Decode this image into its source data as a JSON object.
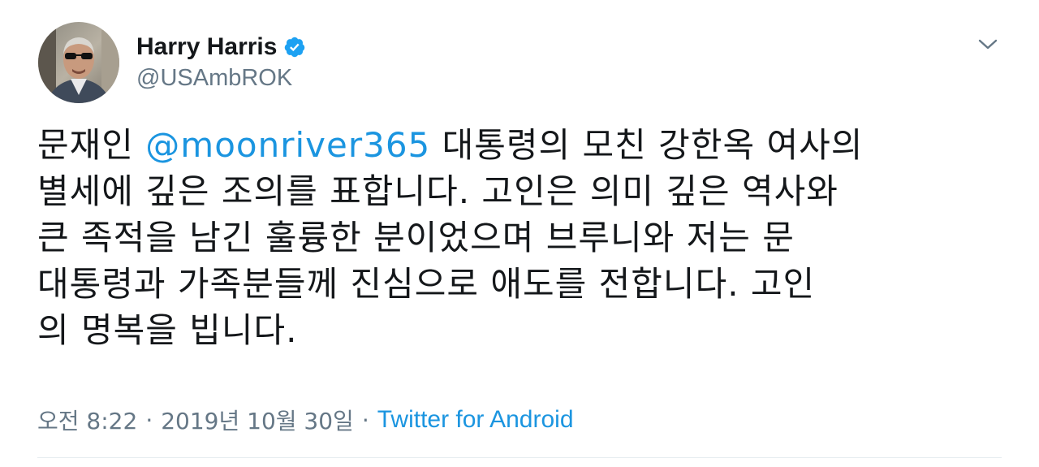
{
  "author": {
    "display_name": "Harry Harris",
    "handle": "@USAmbROK",
    "verified": true,
    "avatar_icon": "profile-photo-sunglasses"
  },
  "tweet": {
    "lines": [
      {
        "pre": "문재인 ",
        "mention": "@moonriver365",
        "post": " 대통령의 모친 강한옥 여사의"
      },
      {
        "text": "별세에 깊은 조의를 표합니다. 고인은 의미 깊은 역사와"
      },
      {
        "text": "큰 족적을 남긴 훌륭한 분이었으며 브루니와 저는 문"
      },
      {
        "text": "대통령과 가족분들께 진심으로 애도를 전합니다. 고인"
      },
      {
        "text": "의 명복을 빕니다."
      }
    ]
  },
  "meta": {
    "time": "오전 8:22",
    "separator": "·",
    "date": "2019년 10월 30일",
    "source": "Twitter for Android"
  },
  "icons": {
    "verified": "verified-badge-icon",
    "menu": "chevron-down-icon"
  },
  "colors": {
    "link": "#1b95e0",
    "text": "#14171a",
    "secondary": "#657786",
    "verified": "#1da1f2"
  }
}
